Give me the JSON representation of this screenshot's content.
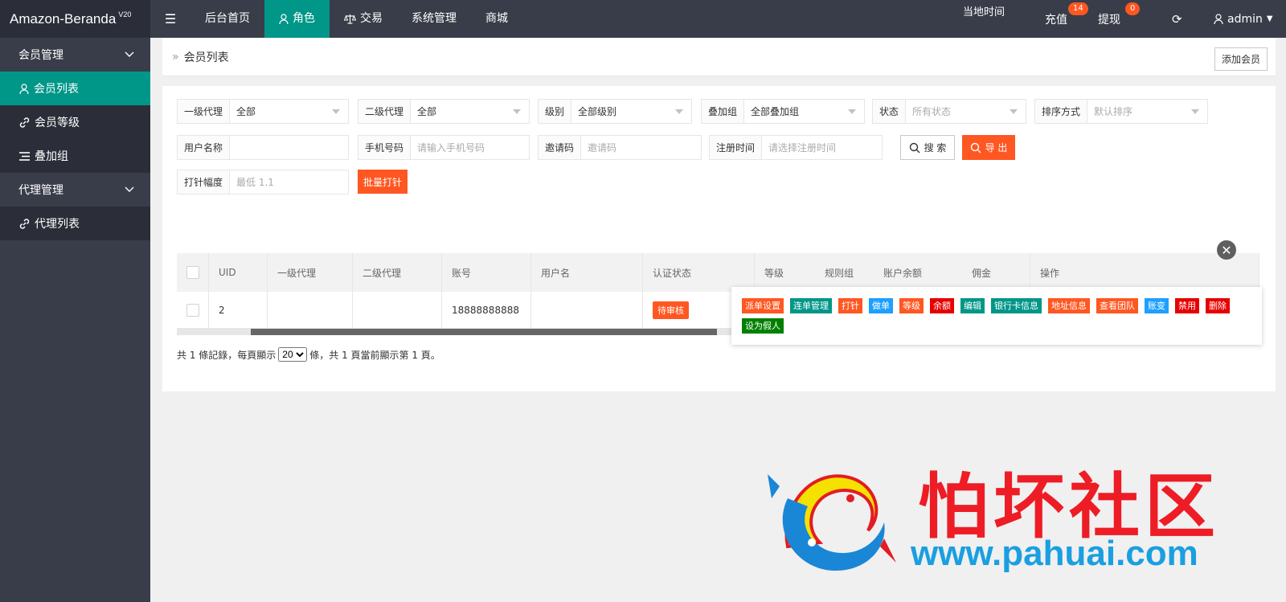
{
  "app": {
    "name": "Amazon-Beranda",
    "version": "V20"
  },
  "topnav": [
    {
      "label": "后台首页",
      "icon": "",
      "active": false
    },
    {
      "label": "角色",
      "icon": "user-icon",
      "active": true
    },
    {
      "label": "交易",
      "icon": "scale-icon",
      "active": false
    },
    {
      "label": "系统管理",
      "icon": "",
      "active": false
    },
    {
      "label": "商城",
      "icon": "",
      "active": false
    }
  ],
  "header": {
    "local_time_label": "当地时间",
    "recharge": {
      "label": "充值",
      "badge": "14"
    },
    "withdraw": {
      "label": "提现",
      "badge": "0"
    },
    "user": "admin"
  },
  "sidebar": {
    "groups": [
      {
        "label": "会员管理",
        "items": [
          {
            "label": "会员列表",
            "icon": "user-icon",
            "active": true
          },
          {
            "label": "会员等级",
            "icon": "link-icon",
            "active": false
          },
          {
            "label": "叠加组",
            "icon": "list-icon",
            "active": false
          }
        ]
      },
      {
        "label": "代理管理",
        "items": [
          {
            "label": "代理列表",
            "icon": "link-icon",
            "active": false
          }
        ]
      }
    ]
  },
  "breadcrumb": {
    "sep": "»",
    "title": "会员列表",
    "add_button": "添加会员"
  },
  "filters": {
    "row1": [
      {
        "label": "一级代理",
        "value": "全部",
        "placeholder": false
      },
      {
        "label": "二级代理",
        "value": "全部",
        "placeholder": false
      },
      {
        "label": "级别",
        "value": "全部级别",
        "placeholder": false
      },
      {
        "label": "叠加组",
        "value": "全部叠加组",
        "placeholder": false
      },
      {
        "label": "状态",
        "value": "所有状态",
        "placeholder": true
      },
      {
        "label": "排序方式",
        "value": "默认排序",
        "placeholder": true
      }
    ],
    "row2": [
      {
        "label": "用户名称",
        "value": ""
      },
      {
        "label": "手机号码",
        "value": "请输入手机号码"
      },
      {
        "label": "邀请码",
        "value": "邀请码"
      },
      {
        "label": "注册时间",
        "value": "请选择注册时间"
      }
    ],
    "search_button": "搜 索",
    "export_button": "导 出",
    "dazhen": {
      "label": "打针幅度",
      "placeholder": "最低 1.1"
    },
    "batch_button": "批量打针"
  },
  "table": {
    "headers": [
      "UID",
      "一级代理",
      "二级代理",
      "账号",
      "用户名",
      "认证状态",
      "等级",
      "规则组",
      "账户余额",
      "佣金",
      "操作"
    ],
    "rows": [
      {
        "uid": "2",
        "agent1": "",
        "agent2": "",
        "account": "18888888888",
        "username": "",
        "status": "待审核"
      }
    ]
  },
  "pager": {
    "before": "共 1 條記錄，每頁顯示",
    "size": "20",
    "after": "條，共 1 頁當前顯示第 1 頁。"
  },
  "operations": [
    {
      "label": "派单设置",
      "color": "#FF5722"
    },
    {
      "label": "连单管理",
      "color": "#009688"
    },
    {
      "label": "打针",
      "color": "#FF5722"
    },
    {
      "label": "做单",
      "color": "#1E9FFF"
    },
    {
      "label": "等级",
      "color": "#FF5722"
    },
    {
      "label": "余额",
      "color": "#e60000"
    },
    {
      "label": "编辑",
      "color": "#009688"
    },
    {
      "label": "银行卡信息",
      "color": "#009688"
    },
    {
      "label": "地址信息",
      "color": "#FF5722"
    },
    {
      "label": "查看团队",
      "color": "#FF5722"
    },
    {
      "label": "账变",
      "color": "#1E9FFF"
    },
    {
      "label": "禁用",
      "color": "#e60000"
    },
    {
      "label": "删除",
      "color": "#e60000"
    },
    {
      "label": "设为假人",
      "color": "#008000"
    }
  ],
  "watermark": {
    "text": "怕坏社区",
    "url": "www.pahuai.com"
  }
}
